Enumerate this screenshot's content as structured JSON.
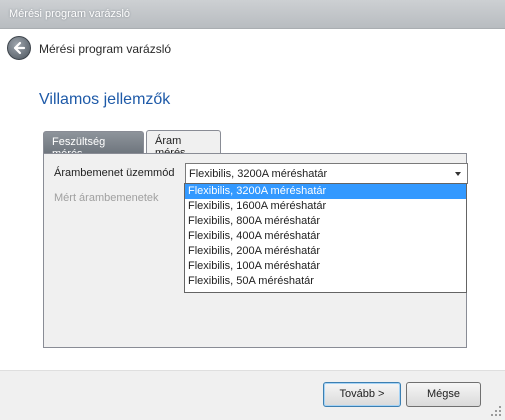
{
  "window": {
    "title": "Mérési program varázsló"
  },
  "header": {
    "title": "Mérési program varázsló",
    "back_icon": "back-arrow-icon"
  },
  "page": {
    "section_title": "Villamos jellemzők"
  },
  "tabs": [
    {
      "label": "Feszültség mérés",
      "active": false
    },
    {
      "label": "Áram mérés",
      "active": true
    }
  ],
  "form": {
    "mode_label": "Árambemenet üzemmód",
    "inputs_label": "Mért árambemenetek",
    "mode_value": "Flexibilis, 3200A méréshatár"
  },
  "dropdown": {
    "options": [
      "Flexibilis, 3200A méréshatár",
      "Flexibilis, 1600A méréshatár",
      "Flexibilis, 800A méréshatár",
      "Flexibilis, 400A méréshatár",
      "Flexibilis, 200A méréshatár",
      "Flexibilis, 100A méréshatár",
      "Flexibilis, 50A méréshatár"
    ],
    "selected_index": 0
  },
  "footer": {
    "next_label": "Tovább >",
    "cancel_label": "Mégse"
  },
  "colors": {
    "accent": "#1e5aa8",
    "selection": "#3399ff"
  }
}
